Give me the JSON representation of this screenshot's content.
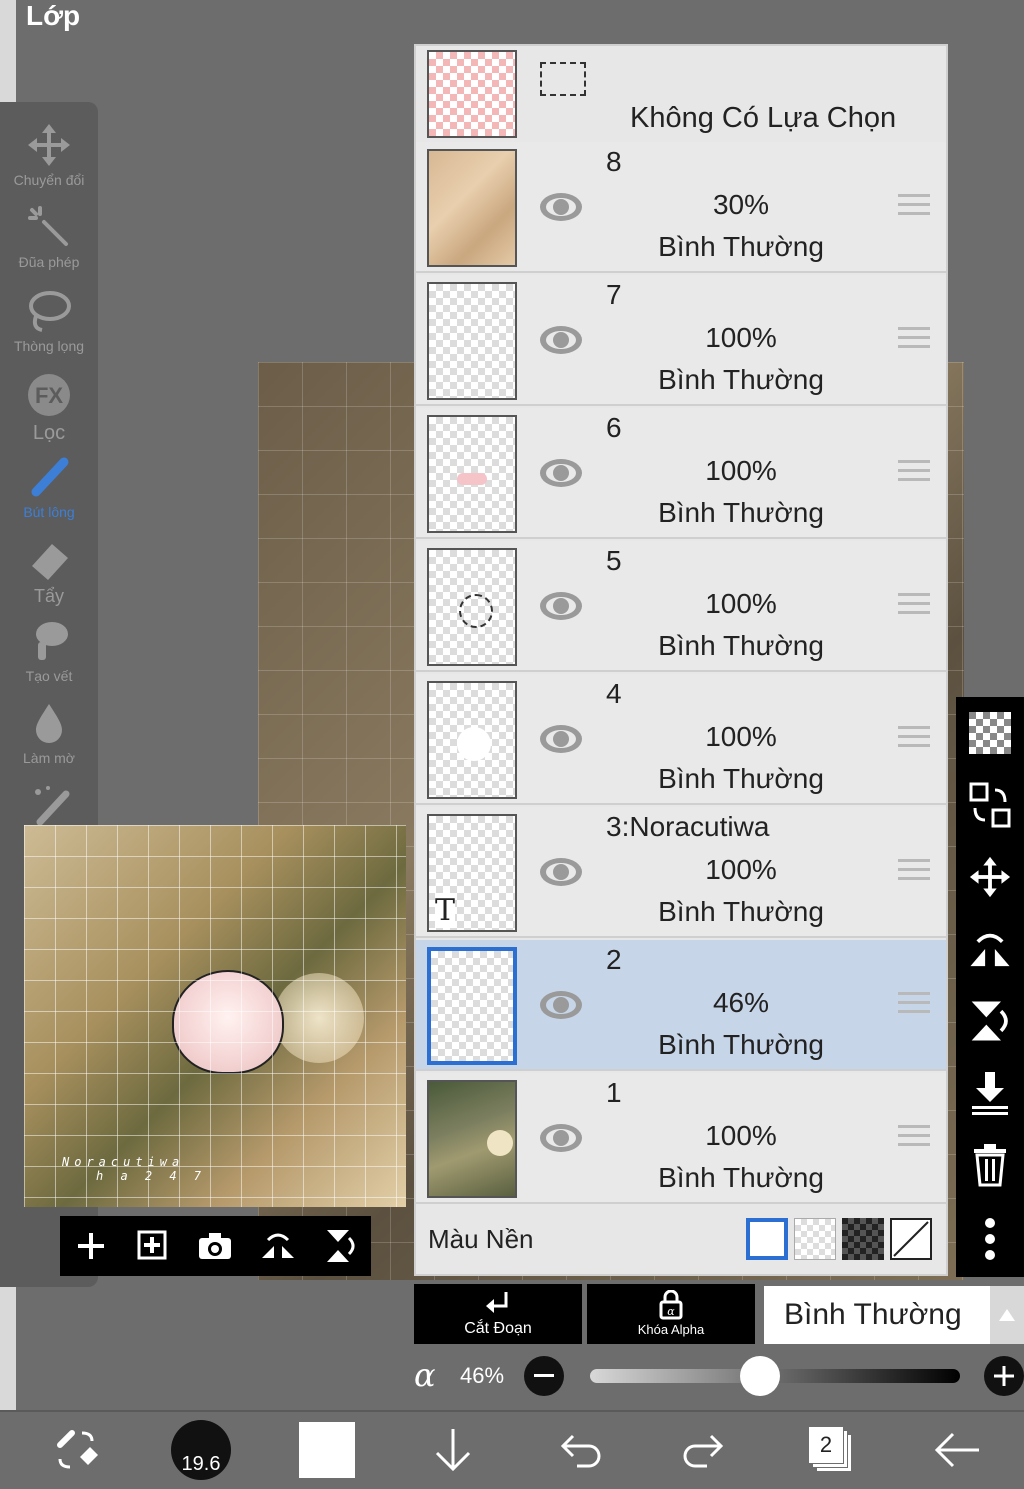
{
  "title": "Lớp",
  "tools": [
    {
      "label": "Chuyển đổi",
      "icon": "move-icon"
    },
    {
      "label": "Đũa phép",
      "icon": "magic-wand-icon"
    },
    {
      "label": "Thòng lọng",
      "icon": "lasso-icon"
    },
    {
      "label": "Lọc",
      "icon": "fx-icon"
    },
    {
      "label": "Bút lông",
      "icon": "brush-icon"
    },
    {
      "label": "Tẩy",
      "icon": "eraser-icon"
    },
    {
      "label": "Tạo vết",
      "icon": "smudge-icon"
    },
    {
      "label": "Làm mờ",
      "icon": "blur-icon"
    }
  ],
  "preview": {
    "signature_line1": "Noracutiwa",
    "signature_line2": "h a 2 4 7"
  },
  "selection_layer": {
    "label": "Không Có Lựa Chọn"
  },
  "layers": [
    {
      "name": "8",
      "opacity": "30%",
      "mode": "Bình Thường"
    },
    {
      "name": "7",
      "opacity": "100%",
      "mode": "Bình Thường"
    },
    {
      "name": "6",
      "opacity": "100%",
      "mode": "Bình Thường"
    },
    {
      "name": "5",
      "opacity": "100%",
      "mode": "Bình Thường"
    },
    {
      "name": "4",
      "opacity": "100%",
      "mode": "Bình Thường"
    },
    {
      "name": "3:Noracutiwa",
      "opacity": "100%",
      "mode": "Bình Thường",
      "text_marker": "T"
    },
    {
      "name": "2",
      "opacity": "46%",
      "mode": "Bình Thường",
      "selected": true
    },
    {
      "name": "1",
      "opacity": "100%",
      "mode": "Bình Thường"
    }
  ],
  "background_label": "Màu Nền",
  "clip_label": "Cắt Đoạn",
  "alpha_lock_label": "Khóa Alpha",
  "blend_mode": "Bình Thường",
  "alpha": {
    "symbol": "α",
    "value": "46%",
    "fraction": 0.46
  },
  "brush_size": "19.6",
  "layer_count": "2",
  "colors": {
    "accent": "#2a6fd1",
    "selected_row": "#c7d5e8",
    "panel": "#e7e7e7",
    "toolbar": "#000000"
  }
}
